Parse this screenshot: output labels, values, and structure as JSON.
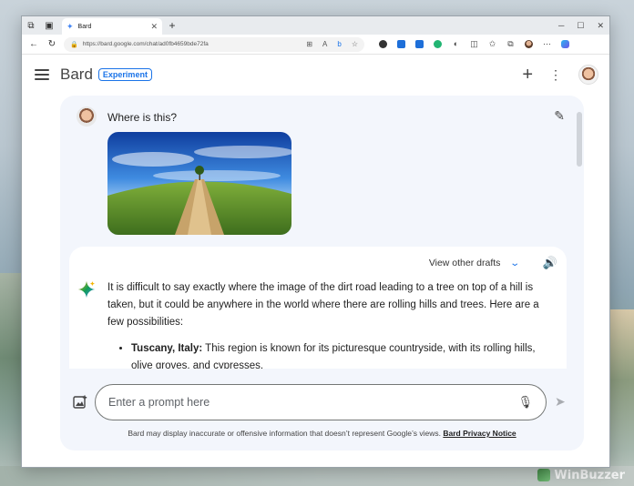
{
  "browser": {
    "tab_title": "Bard",
    "url": "https://bard.google.com/chat/ad0fb4659bde72fa"
  },
  "header": {
    "logo": "Bard",
    "badge": "Experiment"
  },
  "conversation": {
    "user_prompt": "Where is this?",
    "drafts_label": "View other drafts",
    "response_intro": "It is difficult to say exactly where the image of the dirt road leading to a tree on top of a hill is taken, but it could be anywhere in the world where there are rolling hills and trees. Here are a few possibilities:",
    "bullets": [
      {
        "title": "Tuscany, Italy:",
        "text": " This region is known for its picturesque countryside, with its rolling hills, olive groves, and cypresses."
      }
    ]
  },
  "input": {
    "placeholder": "Enter a prompt here",
    "disclaimer": "Bard may display inaccurate or offensive information that doesn’t represent Google’s views.",
    "privacy_link": "Bard Privacy Notice"
  },
  "icons": {
    "bard_sparkle": "sparkle-icon",
    "accent": "#1a73e8"
  },
  "watermark": "WinBuzzer"
}
